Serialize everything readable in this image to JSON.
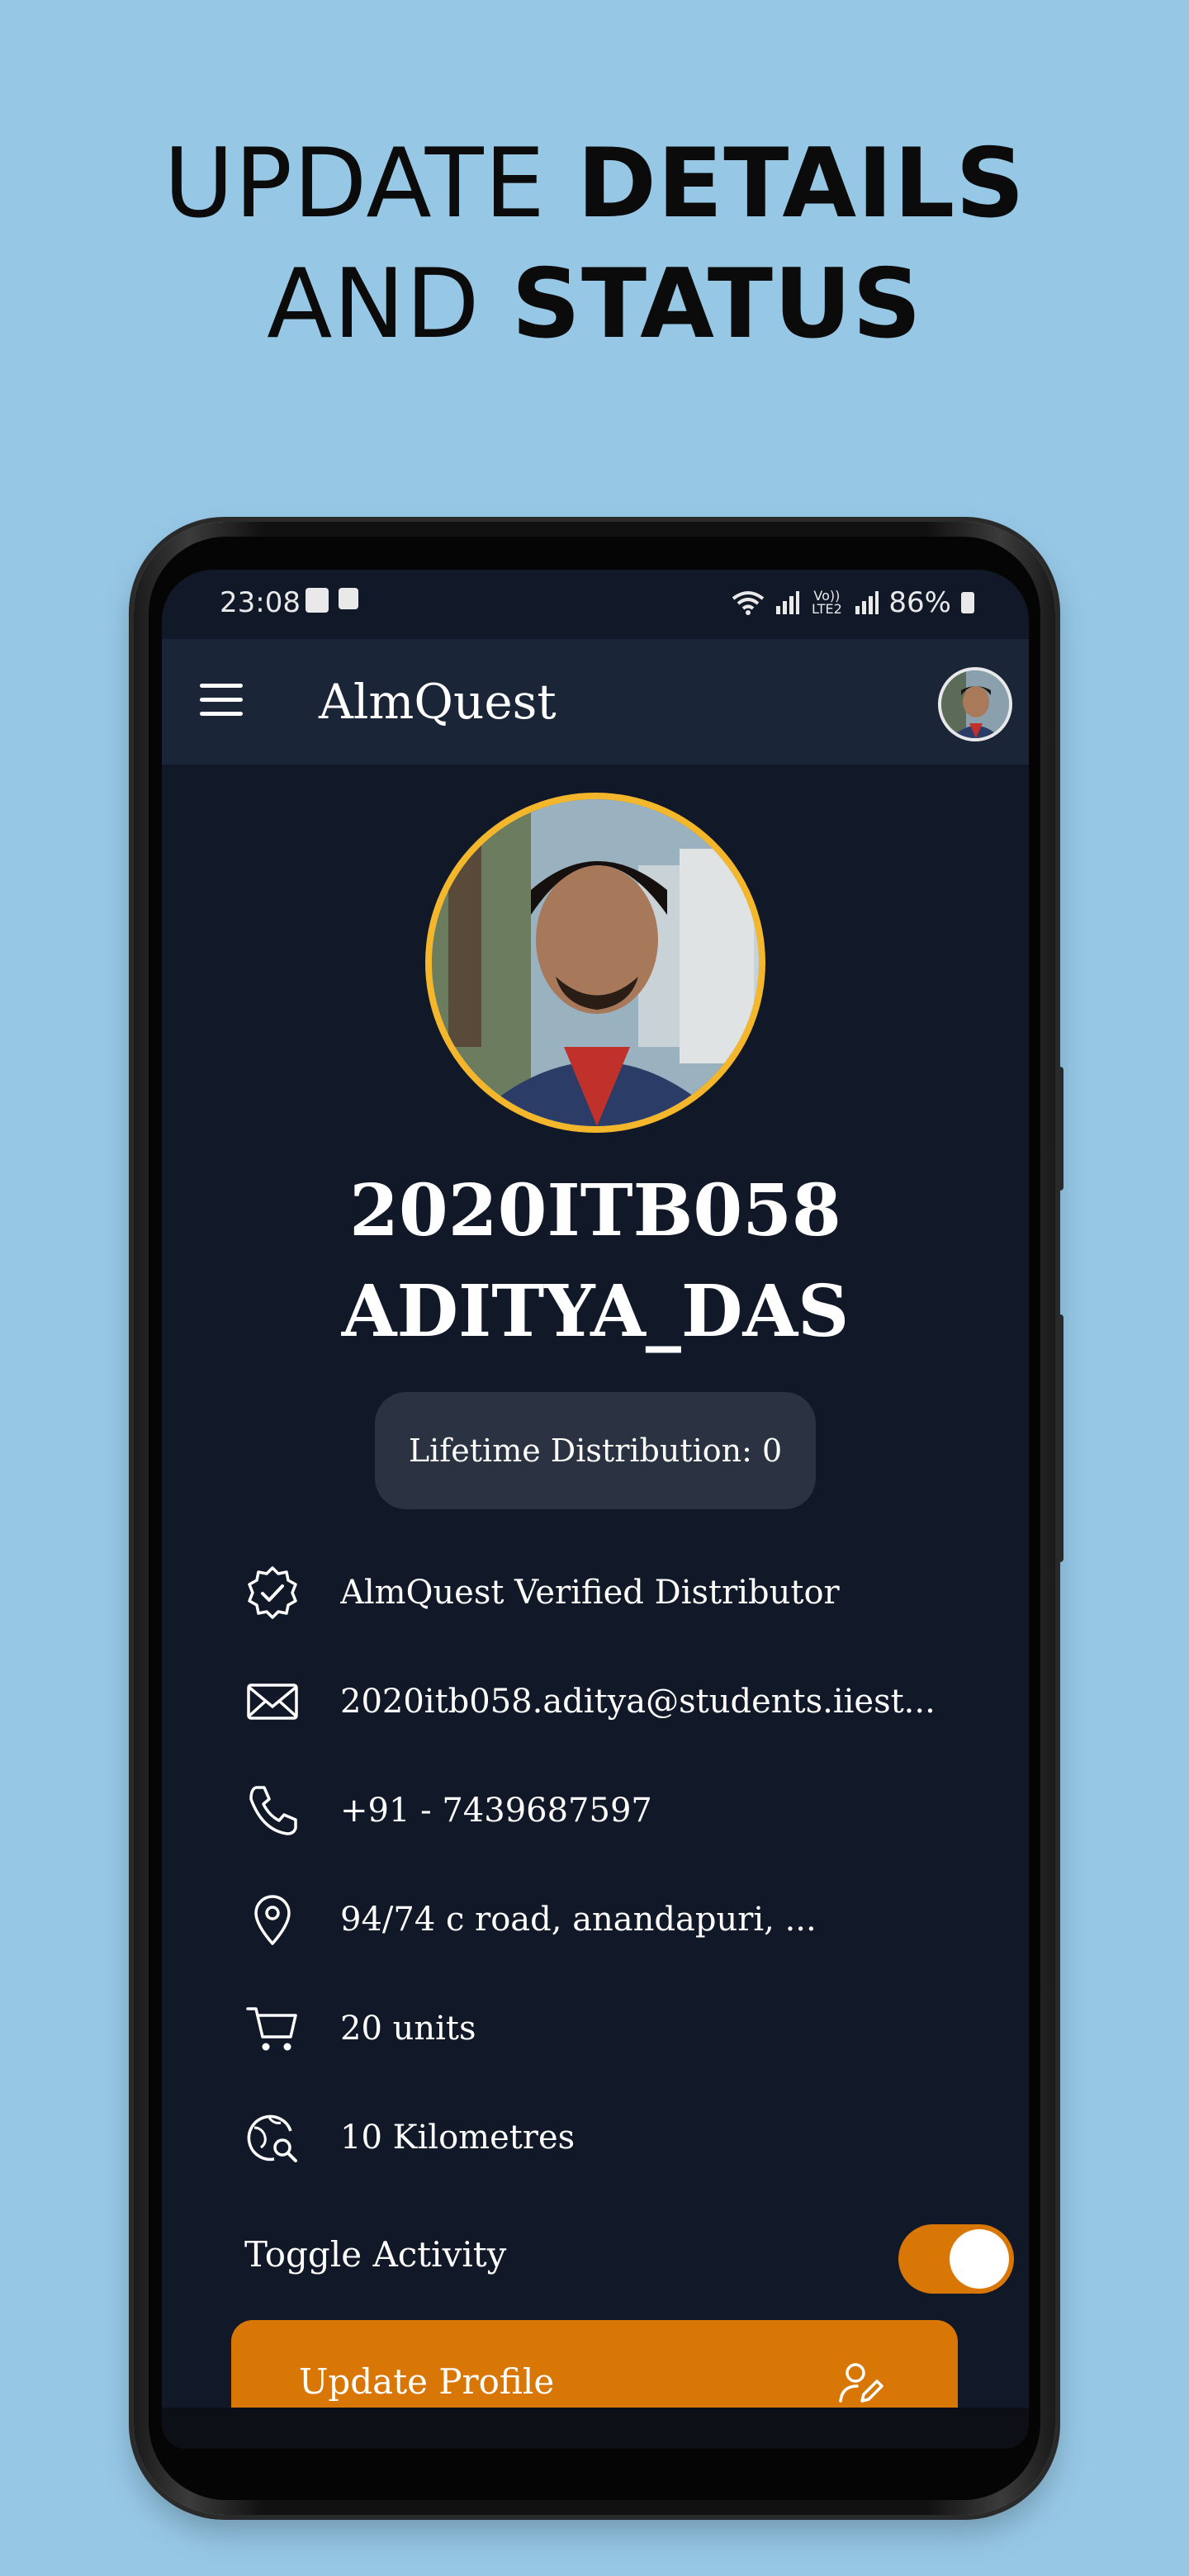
{
  "headline": {
    "line1_light": "UPDATE ",
    "line1_bold": "DETAILS",
    "line2_light": "AND ",
    "line2_bold": "STATUS"
  },
  "status_bar": {
    "time": "23:08",
    "network_label": "Vo)) LTE2",
    "battery": "86%"
  },
  "app_bar": {
    "title": "AlmQuest"
  },
  "profile": {
    "name_line1": "2020ITB058",
    "name_line2": "ADITYA_DAS",
    "lifetime_distribution": "Lifetime Distribution: 0"
  },
  "details": [
    {
      "icon": "verified-badge-icon",
      "text": "AlmQuest Verified Distributor"
    },
    {
      "icon": "mail-icon",
      "text": "2020itb058.aditya@students.iiest..."
    },
    {
      "icon": "phone-icon",
      "text": "+91 - 7439687597"
    },
    {
      "icon": "location-pin-icon",
      "text": "94/74 c road, anandapuri, ..."
    },
    {
      "icon": "cart-icon",
      "text": "20  units"
    },
    {
      "icon": "radius-search-icon",
      "text": "10  Kilometres"
    }
  ],
  "toggle": {
    "label": "Toggle Activity",
    "state": "on"
  },
  "update_button": {
    "label": "Update Profile"
  },
  "colors": {
    "background": "#96c8e6",
    "screen": "#111827",
    "app_bar": "#1b2538",
    "accent": "#d97706",
    "avatar_ring": "#f4b62b"
  }
}
